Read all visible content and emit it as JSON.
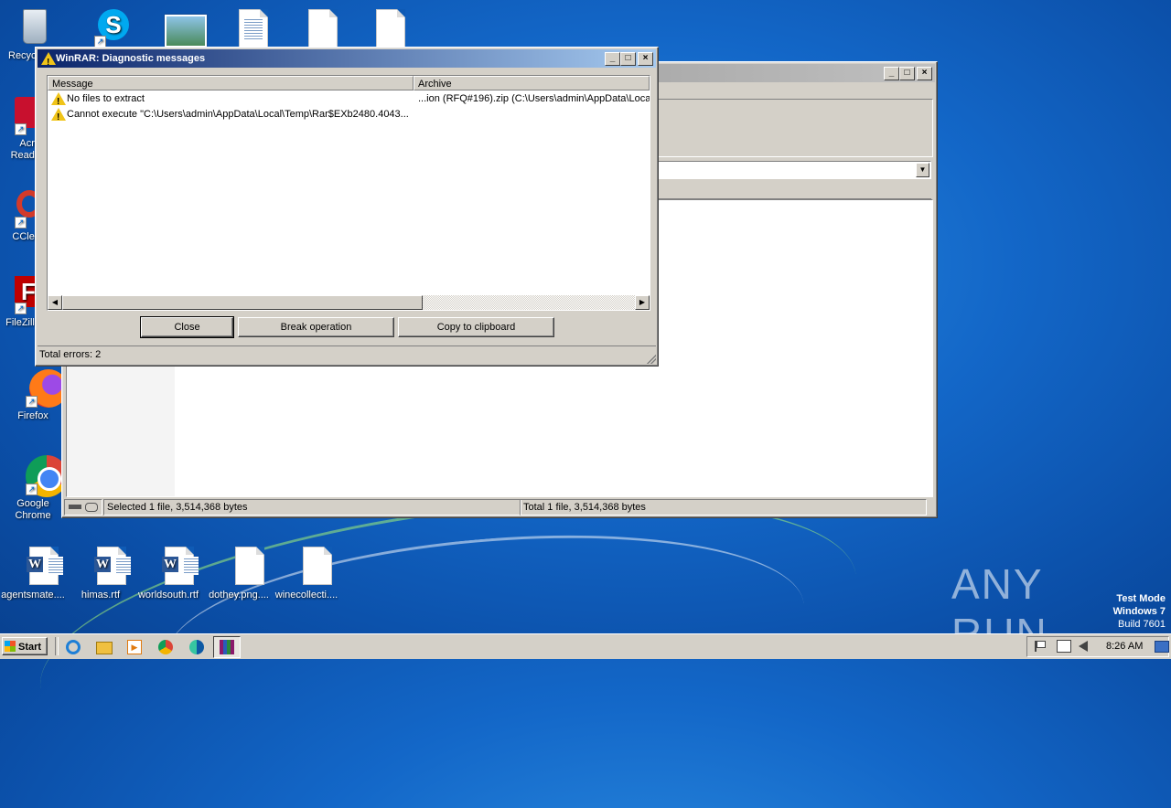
{
  "desktop": {
    "icons": [
      {
        "label": "Recycle Bin",
        "shown": "Recyc"
      },
      {
        "label": "Skype",
        "shown": ""
      },
      {
        "label": "",
        "shown": ""
      },
      {
        "label": "",
        "shown": ""
      },
      {
        "label": "",
        "shown": ""
      },
      {
        "label": "",
        "shown": ""
      },
      {
        "label": "Acrobat Reader",
        "shown": "Acro Reade"
      },
      {
        "label": "CCleaner",
        "shown": "CClea"
      },
      {
        "label": "FileZilla",
        "shown": "FileZilla"
      },
      {
        "label": "Firefox",
        "shown": "Firefox"
      },
      {
        "label": "Google Chrome",
        "shown": "Google Chrome"
      },
      {
        "label": "agentsmate....",
        "shown": "agentsmate...."
      },
      {
        "label": "himas.rtf",
        "shown": "himas.rtf"
      },
      {
        "label": "worldsouth.rtf",
        "shown": "worldsouth.rtf"
      },
      {
        "label": "dothey.png....",
        "shown": "dothey.png...."
      },
      {
        "label": "winecollecti....",
        "shown": "winecollecti...."
      }
    ],
    "watermark": "ANY RUN",
    "test_mode": {
      "line1": "Test Mode",
      "line2": "Windows 7",
      "line3": "Build 7601"
    }
  },
  "bg_window": {
    "status_left": "Selected 1 file, 3,514,368 bytes",
    "status_right": "Total 1 file, 3,514,368 bytes"
  },
  "dialog": {
    "title": "WinRAR: Diagnostic messages",
    "columns": {
      "message": "Message",
      "archive": "Archive"
    },
    "rows": [
      {
        "message": "No files to extract",
        "archive": "...ion (RFQ#196).zip (C:\\Users\\admin\\AppData\\Local"
      },
      {
        "message": "Cannot execute \"C:\\Users\\admin\\AppData\\Local\\Temp\\Rar$EXb2480.4043...",
        "archive": ""
      }
    ],
    "buttons": {
      "close": "Close",
      "break": "Break operation",
      "copy": "Copy to clipboard"
    },
    "status": "Total errors: 2"
  },
  "taskbar": {
    "start_label": "Start",
    "clock": "8:26 AM"
  },
  "colors": {
    "warning": "#f0c419",
    "title_active": "#0a246a"
  }
}
